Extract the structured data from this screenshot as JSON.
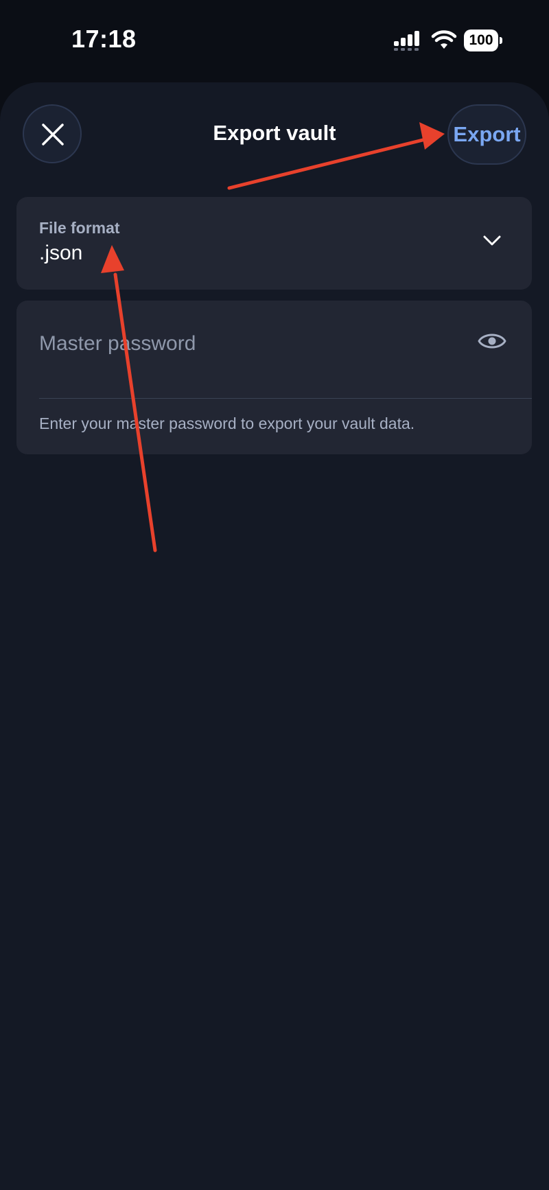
{
  "status_bar": {
    "time": "17:18",
    "battery": "100",
    "icons": [
      "cellular-signal-icon",
      "wifi-icon",
      "battery-icon"
    ]
  },
  "header": {
    "title": "Export vault",
    "close_icon": "close-icon",
    "export_label": "Export"
  },
  "file_format": {
    "label": "File format",
    "value": ".json",
    "icon": "chevron-down-icon"
  },
  "master_password": {
    "placeholder": "Master password",
    "value": "",
    "toggle_icon": "eye-icon",
    "helper": "Enter your master password to export your vault data."
  },
  "colors": {
    "background": "#0b0e15",
    "sheet": "#141925",
    "card": "#222633",
    "accent": "#7aa7f2",
    "annotation": "#e8412c"
  }
}
